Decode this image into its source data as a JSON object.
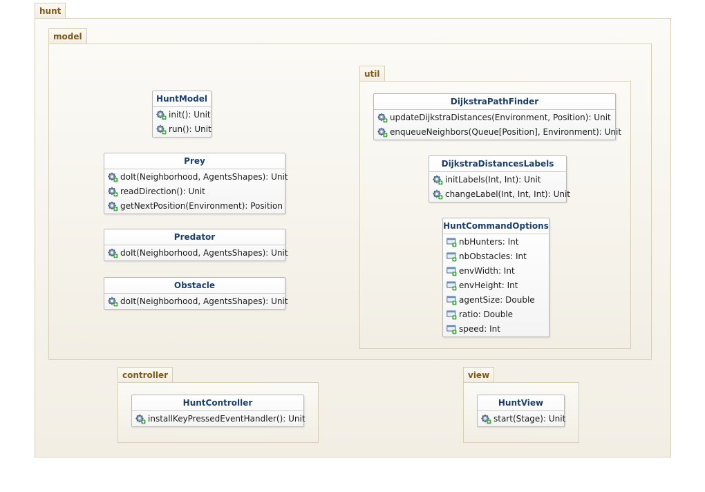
{
  "packages": {
    "hunt": "hunt",
    "model": "model",
    "util": "util",
    "controller": "controller",
    "view": "view"
  },
  "classes": {
    "huntmodel": {
      "name": "HuntModel",
      "members": [
        "init(): Unit",
        "run(): Unit"
      ]
    },
    "prey": {
      "name": "Prey",
      "members": [
        "doIt(Neighborhood, AgentsShapes): Unit",
        "readDirection(): Unit",
        "getNextPosition(Environment): Position"
      ]
    },
    "predator": {
      "name": "Predator",
      "members": [
        "doIt(Neighborhood, AgentsShapes): Unit"
      ]
    },
    "obstacle": {
      "name": "Obstacle",
      "members": [
        "doIt(Neighborhood, AgentsShapes): Unit"
      ]
    },
    "dijkstrapathfinder": {
      "name": "DijkstraPathFinder",
      "members": [
        "updateDijkstraDistances(Environment, Position): Unit",
        "enqueueNeighbors(Queue[Position], Environment): Unit"
      ]
    },
    "dijkstradistanceslabels": {
      "name": "DijkstraDistancesLabels",
      "members": [
        "initLabels(Int, Int): Unit",
        "changeLabel(Int, Int, Int): Unit"
      ]
    },
    "huntcommandoptions": {
      "name": "HuntCommandOptions",
      "members": [
        "nbHunters: Int",
        "nbObstacles: Int",
        "envWidth: Int",
        "envHeight: Int",
        "agentSize: Double",
        "ratio: Double",
        "speed: Int"
      ]
    },
    "huntcontroller": {
      "name": "HuntController",
      "members": [
        "installKeyPressedEventHandler(): Unit"
      ]
    },
    "huntview": {
      "name": "HuntView",
      "members": [
        "start(Stage): Unit"
      ]
    }
  },
  "icons": {
    "method": "method-icon",
    "field": "field-icon"
  },
  "colors": {
    "package_label": "#7b5a1c",
    "class_name": "#1d3f66",
    "package_border": "#d6ceb6"
  }
}
